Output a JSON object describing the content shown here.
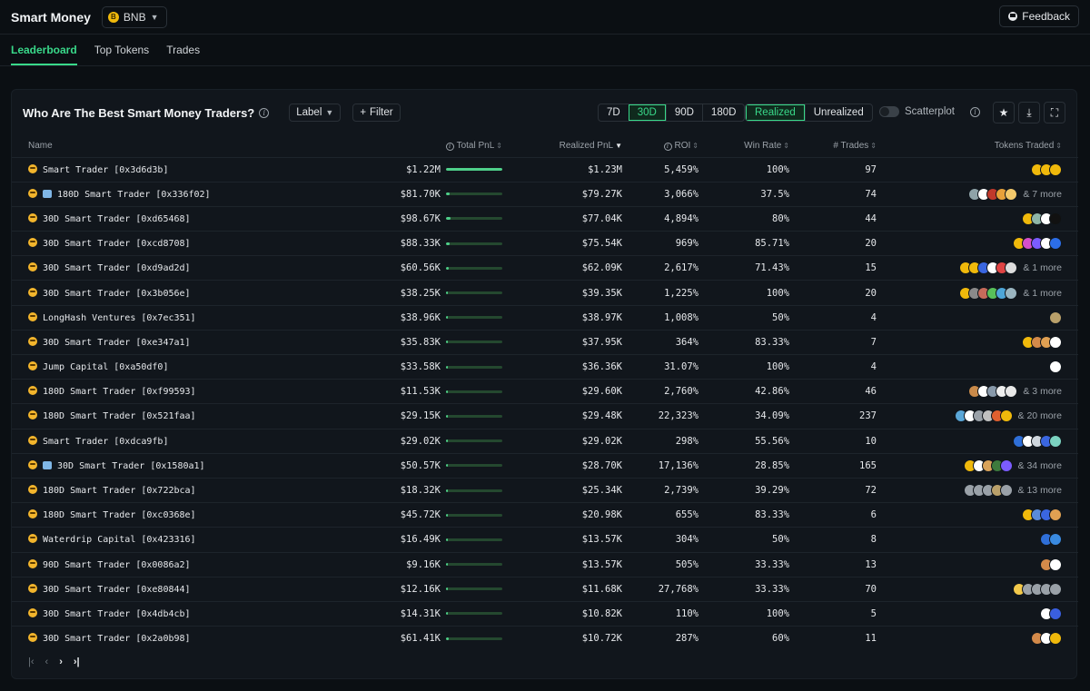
{
  "app": {
    "title": "Smart Money",
    "chain": "BNB",
    "chain_icon": "B",
    "feedback_label": "Feedback"
  },
  "tabs": [
    {
      "label": "Leaderboard",
      "active": true
    },
    {
      "label": "Top Tokens",
      "active": false
    },
    {
      "label": "Trades",
      "active": false
    }
  ],
  "panel": {
    "title": "Who Are The Best Smart Money Traders?",
    "label_button": "Label",
    "filter_button": "Filter",
    "periods": [
      "7D",
      "30D",
      "90D",
      "180D"
    ],
    "active_period": "30D",
    "modes": [
      "Realized",
      "Unrealized"
    ],
    "active_mode": "Realized",
    "scatterplot_label": "Scatterplot",
    "scatterplot_on": false
  },
  "columns": {
    "name": "Name",
    "total_pnl": "Total PnL",
    "realized_pnl": "Realized PnL",
    "roi": "ROI",
    "win_rate": "Win Rate",
    "trades": "# Trades",
    "tokens": "Tokens Traded"
  },
  "rows": [
    {
      "name": "Smart Trader [0x3d6d3b]",
      "bot": false,
      "total_pnl": "$1.22M",
      "bar": 1.0,
      "realized_pnl": "$1.23M",
      "roi": "5,459%",
      "win_rate": "100%",
      "trades": "97",
      "token_colors": [
        "#f0b90b",
        "#f0b90b",
        "#f0b90b"
      ],
      "more": ""
    },
    {
      "name": "180D Smart Trader [0x336f02]",
      "bot": true,
      "total_pnl": "$81.70K",
      "bar": 0.07,
      "realized_pnl": "$79.27K",
      "roi": "3,066%",
      "win_rate": "37.5%",
      "trades": "74",
      "token_colors": [
        "#8fa3a8",
        "#ffffff",
        "#c0392b",
        "#e8a13a",
        "#f3c96b"
      ],
      "more": "& 7 more"
    },
    {
      "name": "30D Smart Trader [0xd65468]",
      "bot": false,
      "total_pnl": "$98.67K",
      "bar": 0.08,
      "realized_pnl": "$77.04K",
      "roi": "4,894%",
      "win_rate": "80%",
      "trades": "44",
      "token_colors": [
        "#f0b90b",
        "#8fb6a8",
        "#ffffff",
        "#111111"
      ],
      "more": ""
    },
    {
      "name": "30D Smart Trader [0xcd8708]",
      "bot": false,
      "total_pnl": "$88.33K",
      "bar": 0.07,
      "realized_pnl": "$75.54K",
      "roi": "969%",
      "win_rate": "85.71%",
      "trades": "20",
      "token_colors": [
        "#f0b90b",
        "#d64fc9",
        "#7b5cff",
        "#ffffff",
        "#2c6ee8"
      ],
      "more": ""
    },
    {
      "name": "30D Smart Trader [0xd9ad2d]",
      "bot": false,
      "total_pnl": "$60.56K",
      "bar": 0.05,
      "realized_pnl": "$62.09K",
      "roi": "2,617%",
      "win_rate": "71.43%",
      "trades": "15",
      "token_colors": [
        "#f0b90b",
        "#f0b90b",
        "#3a66e0",
        "#ffffff",
        "#e04444",
        "#dddddd"
      ],
      "more": "& 1 more"
    },
    {
      "name": "30D Smart Trader [0x3b056e]",
      "bot": false,
      "total_pnl": "$38.25K",
      "bar": 0.03,
      "realized_pnl": "$39.35K",
      "roi": "1,225%",
      "win_rate": "100%",
      "trades": "20",
      "token_colors": [
        "#f0b90b",
        "#8a8a8a",
        "#c56b5b",
        "#58c05a",
        "#4ea6d8",
        "#9ab5c0"
      ],
      "more": "& 1 more"
    },
    {
      "name": "LongHash Ventures [0x7ec351]",
      "bot": false,
      "total_pnl": "$38.96K",
      "bar": 0.03,
      "realized_pnl": "$38.97K",
      "roi": "1,008%",
      "win_rate": "50%",
      "trades": "4",
      "token_colors": [
        "#b9a06a"
      ],
      "more": ""
    },
    {
      "name": "30D Smart Trader [0xe347a1]",
      "bot": false,
      "total_pnl": "$35.83K",
      "bar": 0.03,
      "realized_pnl": "$37.95K",
      "roi": "364%",
      "win_rate": "83.33%",
      "trades": "7",
      "token_colors": [
        "#f0b90b",
        "#d48a4a",
        "#e0a052",
        "#ffffff"
      ],
      "more": ""
    },
    {
      "name": "Jump Capital [0xa50df0]",
      "bot": false,
      "total_pnl": "$33.58K",
      "bar": 0.03,
      "realized_pnl": "$36.36K",
      "roi": "31.07%",
      "win_rate": "100%",
      "trades": "4",
      "token_colors": [
        "#ffffff"
      ],
      "more": ""
    },
    {
      "name": "180D Smart Trader [0xf99593]",
      "bot": false,
      "total_pnl": "$11.53K",
      "bar": 0.01,
      "realized_pnl": "$29.60K",
      "roi": "2,760%",
      "win_rate": "42.86%",
      "trades": "46",
      "token_colors": [
        "#c98a4a",
        "#ffffff",
        "#8899aa",
        "#eeeeee",
        "#e8e8e8"
      ],
      "more": "& 3 more"
    },
    {
      "name": "180D Smart Trader [0x521faa]",
      "bot": false,
      "total_pnl": "$29.15K",
      "bar": 0.02,
      "realized_pnl": "$29.48K",
      "roi": "22,323%",
      "win_rate": "34.09%",
      "trades": "237",
      "token_colors": [
        "#5aa7d8",
        "#ffffff",
        "#9aa1a8",
        "#c0c0c0",
        "#e06030",
        "#f0b90b"
      ],
      "more": "& 20 more"
    },
    {
      "name": "Smart Trader [0xdca9fb]",
      "bot": false,
      "total_pnl": "$29.02K",
      "bar": 0.02,
      "realized_pnl": "$29.02K",
      "roi": "298%",
      "win_rate": "55.56%",
      "trades": "10",
      "token_colors": [
        "#2f6fd8",
        "#ffffff",
        "#cfd6dd",
        "#3a66e0",
        "#7bd2c0"
      ],
      "more": ""
    },
    {
      "name": "30D Smart Trader [0x1580a1]",
      "bot": true,
      "total_pnl": "$50.57K",
      "bar": 0.04,
      "realized_pnl": "$28.70K",
      "roi": "17,136%",
      "win_rate": "28.85%",
      "trades": "165",
      "token_colors": [
        "#f0b90b",
        "#ffffff",
        "#d9a35a",
        "#3d7a3d",
        "#7b5cff"
      ],
      "more": "& 34 more"
    },
    {
      "name": "180D Smart Trader [0x722bca]",
      "bot": false,
      "total_pnl": "$18.32K",
      "bar": 0.02,
      "realized_pnl": "$25.34K",
      "roi": "2,739%",
      "win_rate": "39.29%",
      "trades": "72",
      "token_colors": [
        "#9aa1a8",
        "#9aa1a8",
        "#9aa1a8",
        "#b9a06a",
        "#9aa1a8"
      ],
      "more": "& 13 more"
    },
    {
      "name": "180D Smart Trader [0xc0368e]",
      "bot": false,
      "total_pnl": "$45.72K",
      "bar": 0.04,
      "realized_pnl": "$20.98K",
      "roi": "655%",
      "win_rate": "83.33%",
      "trades": "6",
      "token_colors": [
        "#f0b90b",
        "#5a8bd8",
        "#3a66e0",
        "#e0a052"
      ],
      "more": ""
    },
    {
      "name": "Waterdrip Capital [0x423316]",
      "bot": false,
      "total_pnl": "$16.49K",
      "bar": 0.01,
      "realized_pnl": "$13.57K",
      "roi": "304%",
      "win_rate": "50%",
      "trades": "8",
      "token_colors": [
        "#2f6fd8",
        "#3a8ae0"
      ],
      "more": ""
    },
    {
      "name": "90D Smart Trader [0x0086a2]",
      "bot": false,
      "total_pnl": "$9.16K",
      "bar": 0.01,
      "realized_pnl": "$13.57K",
      "roi": "505%",
      "win_rate": "33.33%",
      "trades": "13",
      "token_colors": [
        "#d48a4a",
        "#ffffff"
      ],
      "more": ""
    },
    {
      "name": "30D Smart Trader [0xe80844]",
      "bot": false,
      "total_pnl": "$12.16K",
      "bar": 0.01,
      "realized_pnl": "$11.68K",
      "roi": "27,768%",
      "win_rate": "33.33%",
      "trades": "70",
      "token_colors": [
        "#f3c94b",
        "#9aa1a8",
        "#9aa1a8",
        "#9aa1a8",
        "#9aa1a8"
      ],
      "more": ""
    },
    {
      "name": "30D Smart Trader [0x4db4cb]",
      "bot": false,
      "total_pnl": "$14.31K",
      "bar": 0.01,
      "realized_pnl": "$10.82K",
      "roi": "110%",
      "win_rate": "100%",
      "trades": "5",
      "token_colors": [
        "#ffffff",
        "#3a5fe0"
      ],
      "more": ""
    },
    {
      "name": "30D Smart Trader [0x2a0b98]",
      "bot": false,
      "total_pnl": "$61.41K",
      "bar": 0.05,
      "realized_pnl": "$10.72K",
      "roi": "287%",
      "win_rate": "60%",
      "trades": "11",
      "token_colors": [
        "#d48a4a",
        "#ffffff",
        "#f0b90b"
      ],
      "more": ""
    }
  ],
  "pager": {
    "first": "|‹",
    "prev": "‹",
    "next": "›",
    "last": "›|"
  },
  "colors": {
    "accent": "#39d98a",
    "bar": "#4fd08a",
    "bnb": "#f0b90b"
  }
}
